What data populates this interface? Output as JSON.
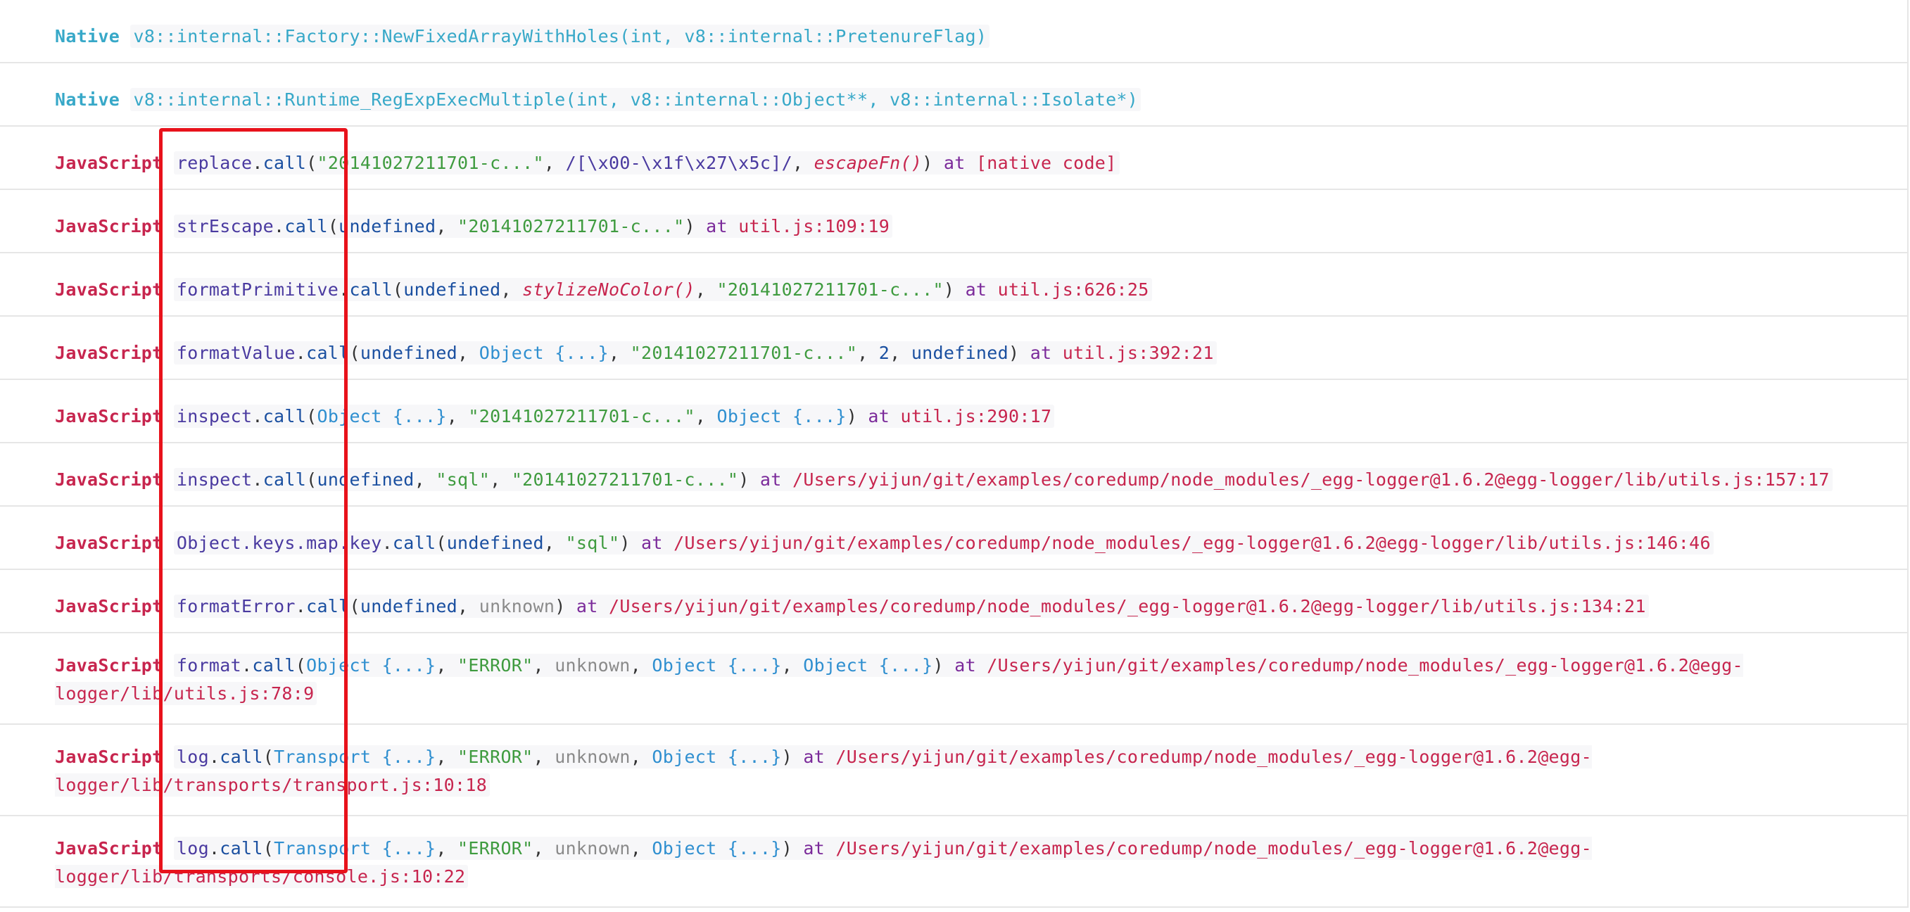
{
  "frames": [
    {
      "type": "Native",
      "kind": "native",
      "parts": [
        {
          "t": "v8::internal::Factory::NewFixedArrayWithHoles(int, v8::internal::PretenureFlag)",
          "c": "native-sig"
        }
      ]
    },
    {
      "type": "Native",
      "kind": "native",
      "parts": [
        {
          "t": "v8::internal::Runtime_RegExpExecMultiple(int, v8::internal::Object**, v8::internal::Isolate*)",
          "c": "native-sig"
        }
      ]
    },
    {
      "type": "JavaScript",
      "kind": "js",
      "parts": [
        {
          "t": "replace",
          "c": "fn"
        },
        {
          "t": ".",
          "c": "dot"
        },
        {
          "t": "call",
          "c": "call"
        },
        {
          "t": "(",
          "c": "punc"
        },
        {
          "t": "\"20141027211701-c...\"",
          "c": "str"
        },
        {
          "t": ", ",
          "c": "punc"
        },
        {
          "t": "/[\\x00-\\x1f\\x27\\x5c]/",
          "c": "regexp"
        },
        {
          "t": ", ",
          "c": "punc"
        },
        {
          "t": "escapeFn()",
          "c": "italic-fn"
        },
        {
          "t": ") ",
          "c": "punc"
        },
        {
          "t": "at ",
          "c": "at"
        },
        {
          "t": "[native code]",
          "c": "loc"
        }
      ]
    },
    {
      "type": "JavaScript",
      "kind": "js",
      "parts": [
        {
          "t": "strEscape",
          "c": "fn"
        },
        {
          "t": ".",
          "c": "dot"
        },
        {
          "t": "call",
          "c": "call"
        },
        {
          "t": "(",
          "c": "punc"
        },
        {
          "t": "undefined",
          "c": "kw-undef"
        },
        {
          "t": ", ",
          "c": "punc"
        },
        {
          "t": "\"20141027211701-c...\"",
          "c": "str"
        },
        {
          "t": ") ",
          "c": "punc"
        },
        {
          "t": "at ",
          "c": "at"
        },
        {
          "t": "util.js:109:19",
          "c": "loc"
        }
      ]
    },
    {
      "type": "JavaScript",
      "kind": "js",
      "parts": [
        {
          "t": "formatPrimitive",
          "c": "fn"
        },
        {
          "t": ".",
          "c": "dot"
        },
        {
          "t": "call",
          "c": "call"
        },
        {
          "t": "(",
          "c": "punc"
        },
        {
          "t": "undefined",
          "c": "kw-undef"
        },
        {
          "t": ", ",
          "c": "punc"
        },
        {
          "t": "stylizeNoColor()",
          "c": "italic-fn"
        },
        {
          "t": ", ",
          "c": "punc"
        },
        {
          "t": "\"20141027211701-c...\"",
          "c": "str"
        },
        {
          "t": ") ",
          "c": "punc"
        },
        {
          "t": "at ",
          "c": "at"
        },
        {
          "t": "util.js:626:25",
          "c": "loc"
        }
      ]
    },
    {
      "type": "JavaScript",
      "kind": "js",
      "parts": [
        {
          "t": "formatValue",
          "c": "fn"
        },
        {
          "t": ".",
          "c": "dot"
        },
        {
          "t": "call",
          "c": "call"
        },
        {
          "t": "(",
          "c": "punc"
        },
        {
          "t": "undefined",
          "c": "kw-undef"
        },
        {
          "t": ", ",
          "c": "punc"
        },
        {
          "t": "Object {...}",
          "c": "obj"
        },
        {
          "t": ", ",
          "c": "punc"
        },
        {
          "t": "\"20141027211701-c...\"",
          "c": "str"
        },
        {
          "t": ", ",
          "c": "punc"
        },
        {
          "t": "2",
          "c": "num"
        },
        {
          "t": ", ",
          "c": "punc"
        },
        {
          "t": "undefined",
          "c": "kw-undef"
        },
        {
          "t": ") ",
          "c": "punc"
        },
        {
          "t": "at ",
          "c": "at"
        },
        {
          "t": "util.js:392:21",
          "c": "loc"
        }
      ]
    },
    {
      "type": "JavaScript",
      "kind": "js",
      "parts": [
        {
          "t": "inspect",
          "c": "fn"
        },
        {
          "t": ".",
          "c": "dot"
        },
        {
          "t": "call",
          "c": "call"
        },
        {
          "t": "(",
          "c": "punc"
        },
        {
          "t": "Object {...}",
          "c": "obj"
        },
        {
          "t": ", ",
          "c": "punc"
        },
        {
          "t": "\"20141027211701-c...\"",
          "c": "str"
        },
        {
          "t": ", ",
          "c": "punc"
        },
        {
          "t": "Object {...}",
          "c": "obj"
        },
        {
          "t": ") ",
          "c": "punc"
        },
        {
          "t": "at ",
          "c": "at"
        },
        {
          "t": "util.js:290:17",
          "c": "loc"
        }
      ]
    },
    {
      "type": "JavaScript",
      "kind": "js",
      "parts": [
        {
          "t": "inspect",
          "c": "fn"
        },
        {
          "t": ".",
          "c": "dot"
        },
        {
          "t": "call",
          "c": "call"
        },
        {
          "t": "(",
          "c": "punc"
        },
        {
          "t": "undefined",
          "c": "kw-undef"
        },
        {
          "t": ", ",
          "c": "punc"
        },
        {
          "t": "\"sql\"",
          "c": "str"
        },
        {
          "t": ", ",
          "c": "punc"
        },
        {
          "t": "\"20141027211701-c...\"",
          "c": "str"
        },
        {
          "t": ") ",
          "c": "punc"
        },
        {
          "t": "at ",
          "c": "at"
        },
        {
          "t": "/Users/yijun/git/examples/coredump/node_modules/_egg-logger@1.6.2@egg-logger/lib/utils.js:157:17",
          "c": "loc"
        }
      ]
    },
    {
      "type": "JavaScript",
      "kind": "js",
      "parts": [
        {
          "t": "Object.keys.map.key",
          "c": "fn"
        },
        {
          "t": ".",
          "c": "dot"
        },
        {
          "t": "call",
          "c": "call"
        },
        {
          "t": "(",
          "c": "punc"
        },
        {
          "t": "undefined",
          "c": "kw-undef"
        },
        {
          "t": ", ",
          "c": "punc"
        },
        {
          "t": "\"sql\"",
          "c": "str"
        },
        {
          "t": ") ",
          "c": "punc"
        },
        {
          "t": "at ",
          "c": "at"
        },
        {
          "t": "/Users/yijun/git/examples/coredump/node_modules/_egg-logger@1.6.2@egg-logger/lib/utils.js:146:46",
          "c": "loc"
        }
      ]
    },
    {
      "type": "JavaScript",
      "kind": "js",
      "parts": [
        {
          "t": "formatError",
          "c": "fn"
        },
        {
          "t": ".",
          "c": "dot"
        },
        {
          "t": "call",
          "c": "call"
        },
        {
          "t": "(",
          "c": "punc"
        },
        {
          "t": "undefined",
          "c": "kw-undef"
        },
        {
          "t": ", ",
          "c": "punc"
        },
        {
          "t": "unknown",
          "c": "unknown"
        },
        {
          "t": ") ",
          "c": "punc"
        },
        {
          "t": "at ",
          "c": "at"
        },
        {
          "t": "/Users/yijun/git/examples/coredump/node_modules/_egg-logger@1.6.2@egg-logger/lib/utils.js:134:21",
          "c": "loc"
        }
      ]
    },
    {
      "type": "JavaScript",
      "kind": "js",
      "tall": true,
      "parts": [
        {
          "t": "format",
          "c": "fn"
        },
        {
          "t": ".",
          "c": "dot"
        },
        {
          "t": "call",
          "c": "call"
        },
        {
          "t": "(",
          "c": "punc"
        },
        {
          "t": "Object {...}",
          "c": "obj"
        },
        {
          "t": ", ",
          "c": "punc"
        },
        {
          "t": "\"ERROR\"",
          "c": "str"
        },
        {
          "t": ", ",
          "c": "punc"
        },
        {
          "t": "unknown",
          "c": "unknown"
        },
        {
          "t": ", ",
          "c": "punc"
        },
        {
          "t": "Object {...}",
          "c": "obj"
        },
        {
          "t": ", ",
          "c": "punc"
        },
        {
          "t": "Object {...}",
          "c": "obj"
        },
        {
          "t": ") ",
          "c": "punc"
        },
        {
          "t": "at ",
          "c": "at"
        },
        {
          "t": "/Users/yijun/git/examples/coredump/node_modules/_egg-logger@1.6.2@egg-\nlogger/lib/utils.js:78:9",
          "c": "loc"
        }
      ]
    },
    {
      "type": "JavaScript",
      "kind": "js",
      "tall": true,
      "parts": [
        {
          "t": "log",
          "c": "fn"
        },
        {
          "t": ".",
          "c": "dot"
        },
        {
          "t": "call",
          "c": "call"
        },
        {
          "t": "(",
          "c": "punc"
        },
        {
          "t": "Transport {...}",
          "c": "obj"
        },
        {
          "t": ", ",
          "c": "punc"
        },
        {
          "t": "\"ERROR\"",
          "c": "str"
        },
        {
          "t": ", ",
          "c": "punc"
        },
        {
          "t": "unknown",
          "c": "unknown"
        },
        {
          "t": ", ",
          "c": "punc"
        },
        {
          "t": "Object {...}",
          "c": "obj"
        },
        {
          "t": ") ",
          "c": "punc"
        },
        {
          "t": "at ",
          "c": "at"
        },
        {
          "t": "/Users/yijun/git/examples/coredump/node_modules/_egg-logger@1.6.2@egg-\nlogger/lib/transports/transport.js:10:18",
          "c": "loc"
        }
      ]
    },
    {
      "type": "JavaScript",
      "kind": "js",
      "tall": true,
      "parts": [
        {
          "t": "log",
          "c": "fn"
        },
        {
          "t": ".",
          "c": "dot"
        },
        {
          "t": "call",
          "c": "call"
        },
        {
          "t": "(",
          "c": "punc"
        },
        {
          "t": "Transport {...}",
          "c": "obj"
        },
        {
          "t": ", ",
          "c": "punc"
        },
        {
          "t": "\"ERROR\"",
          "c": "str"
        },
        {
          "t": ", ",
          "c": "punc"
        },
        {
          "t": "unknown",
          "c": "unknown"
        },
        {
          "t": ", ",
          "c": "punc"
        },
        {
          "t": "Object {...}",
          "c": "obj"
        },
        {
          "t": ") ",
          "c": "punc"
        },
        {
          "t": "at ",
          "c": "at"
        },
        {
          "t": "/Users/yijun/git/examples/coredump/node_modules/_egg-logger@1.6.2@egg-\nlogger/lib/transports/console.js:10:22",
          "c": "loc"
        }
      ]
    }
  ],
  "colors": {
    "native": "#37a8c8",
    "javascript": "#c7254e",
    "highlight_box": "#e8121b"
  }
}
